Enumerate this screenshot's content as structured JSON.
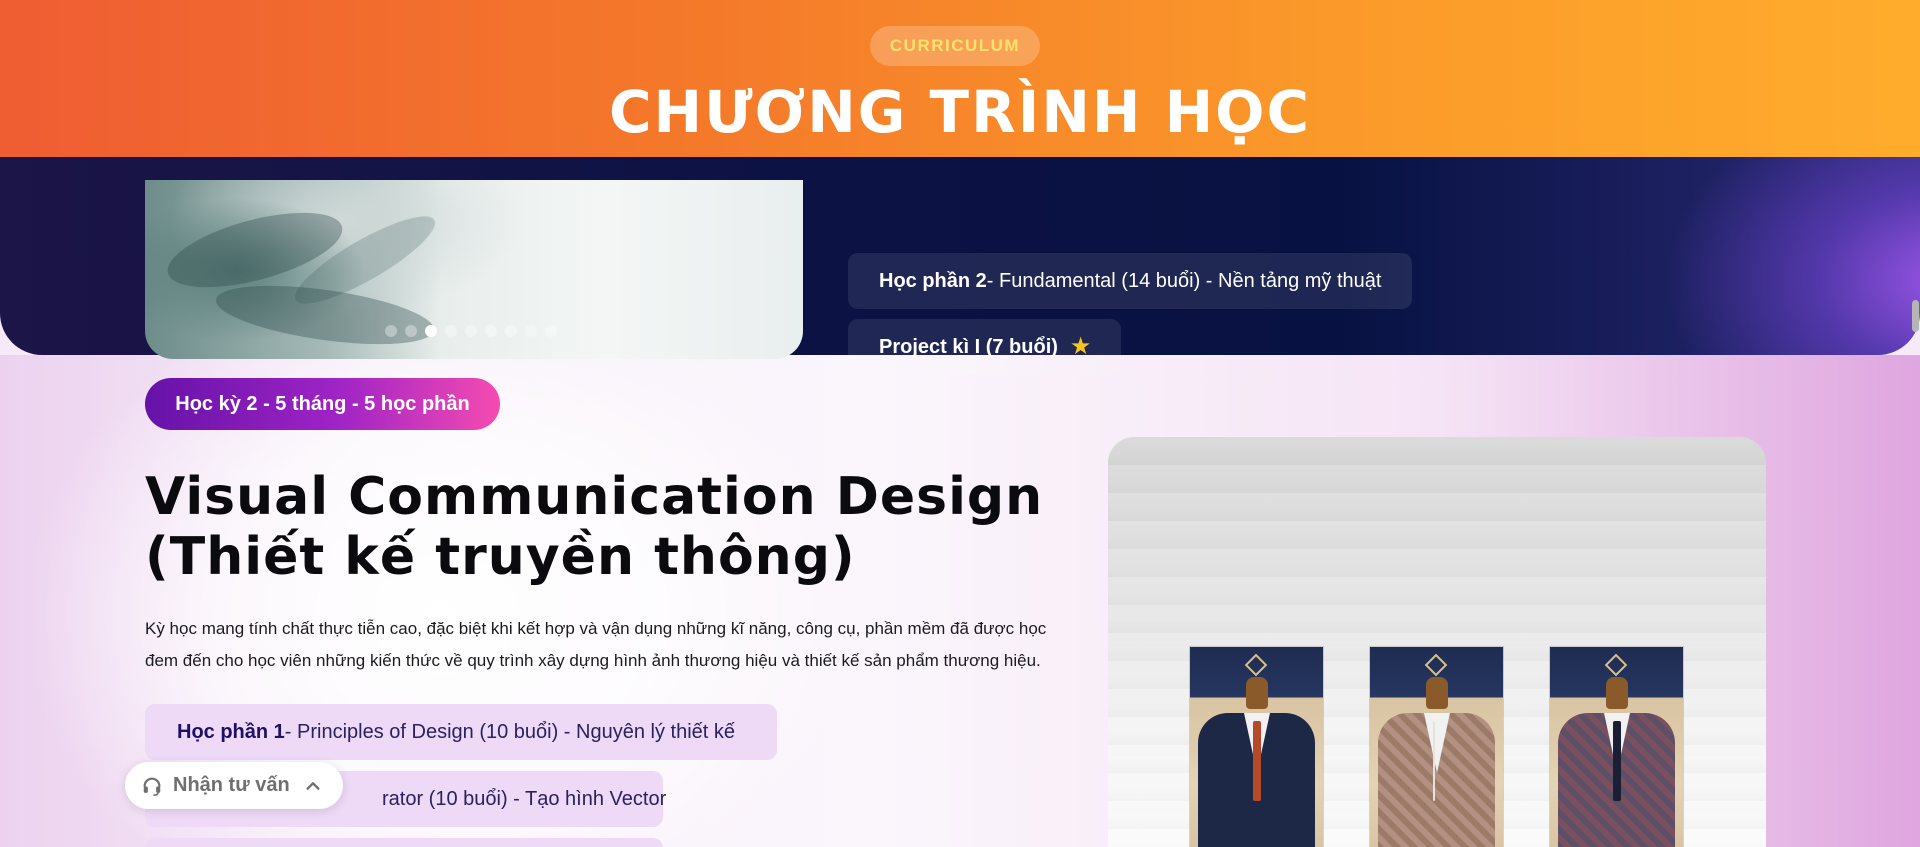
{
  "header": {
    "eyebrow": "CURRICULUM",
    "title": "CHƯƠNG TRÌNH HỌC"
  },
  "term1": {
    "slider": {
      "dot_count": 9,
      "active_index": 2
    },
    "modules": [
      {
        "label": "Học phần 2",
        "text": " - Fundamental (14 buổi) - Nền tảng mỹ thuật"
      },
      {
        "label": "Project kì I (7 buổi)",
        "icon": "star-icon"
      }
    ]
  },
  "term2": {
    "badge": "Học kỳ 2 - 5 tháng - 5 học phần",
    "heading_line1": "Visual Communication Design",
    "heading_line2": "(Thiết kế truyền thông)",
    "description_line1": "Kỳ học mang tính chất thực tiễn cao, đặc biệt khi kết hợp và vận dụng những kĩ năng, công cụ, phần mềm đã được học",
    "description_line2": "đem đến cho học viên những kiến thức về quy trình xây dựng hình ảnh thương hiệu và thiết kế sản phẩm thương hiệu.",
    "modules": [
      {
        "label": "Học phần 1",
        "text": " - Principles of Design (10 buổi) - Nguyên lý thiết kế"
      },
      {
        "label": "",
        "text": "rator (10 buổi) - Tạo hình Vector"
      }
    ]
  },
  "consult_widget": {
    "label": "Nhận tư vấn",
    "icon": "headset-icon",
    "toggle_icon": "chevron-up-icon"
  },
  "colors": {
    "header_start": "#ef5d33",
    "header_end": "#ffac2c",
    "navy": "#0d1244",
    "badge_start": "#6512a8",
    "badge_end": "#f54bb0",
    "star": "#f7c418"
  }
}
